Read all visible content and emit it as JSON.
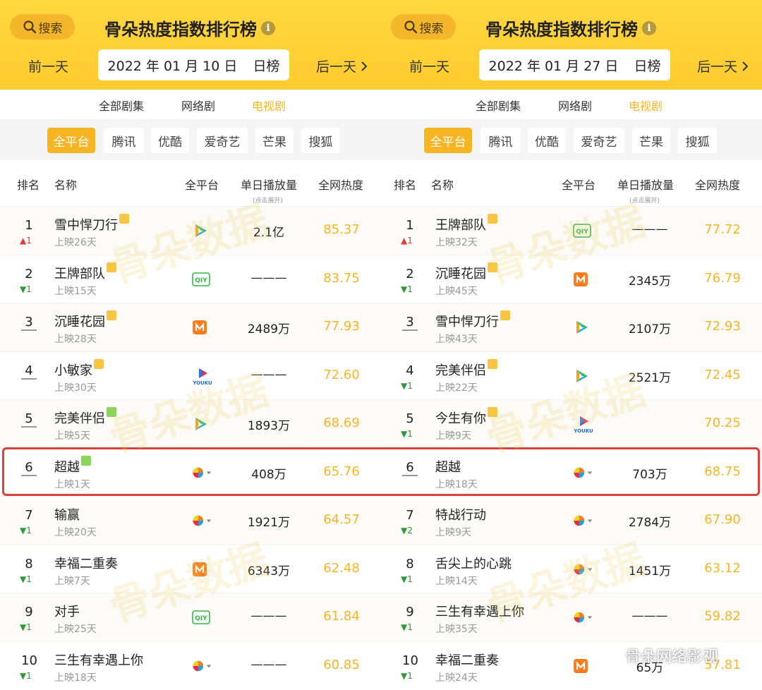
{
  "colors": {
    "header_yellow": "#ffd23a",
    "accent": "#f7b524",
    "up": "#e23c3c",
    "down": "#2e9a3a",
    "highlight": "#d9413a"
  },
  "watermark_text": "骨朵数据",
  "watermark_sub": "@骨朵网络影视",
  "footer": {
    "account": "骨朵网络影视",
    "icon": "wechat-icon"
  },
  "panels": [
    {
      "search_label": "搜索",
      "title": "骨朵热度指数排行榜",
      "prev_label": "前一天",
      "date": "2022 年 01 月 10 日",
      "board": "日榜",
      "next_label": "后一天",
      "categories": [
        "全部剧集",
        "网络剧",
        "电视剧"
      ],
      "platforms": [
        "全平台",
        "腾讯",
        "优酷",
        "爱奇艺",
        "芒果",
        "搜狐"
      ],
      "columns": {
        "rank": "排名",
        "name": "名称",
        "platform": "全平台",
        "plays": "单日播放量",
        "plays_hint": "(点击展开)",
        "heat": "全网热度"
      },
      "rows": [
        {
          "rank": "1",
          "trend": "1",
          "trend_dir": "up",
          "name": "雪中悍刀行",
          "tag": "orange",
          "days": "上映26天",
          "platform": "tencent",
          "plays": "2.1亿",
          "heat": "85.37"
        },
        {
          "rank": "2",
          "trend": "1",
          "trend_dir": "down",
          "name": "王牌部队",
          "tag": "orange",
          "days": "上映15天",
          "platform": "iqiyi",
          "plays": "———",
          "heat": "83.75"
        },
        {
          "rank": "3",
          "trend": "",
          "trend_dir": "flat",
          "name": "沉睡花园",
          "tag": "orange",
          "days": "上映28天",
          "platform": "mango",
          "plays": "2489万",
          "heat": "77.93"
        },
        {
          "rank": "4",
          "trend": "",
          "trend_dir": "flat",
          "name": "小敏家",
          "tag": "orange",
          "days": "上映30天",
          "platform": "youku",
          "plays": "———",
          "heat": "72.60"
        },
        {
          "rank": "5",
          "trend": "",
          "trend_dir": "flat",
          "name": "完美伴侣",
          "tag": "green",
          "days": "上映5天",
          "platform": "tencent",
          "plays": "1893万",
          "heat": "68.69"
        },
        {
          "rank": "6",
          "trend": "",
          "trend_dir": "flat",
          "name": "超越",
          "tag": "green",
          "days": "上映1天",
          "platform": "multi",
          "plays": "408万",
          "heat": "65.76"
        },
        {
          "rank": "7",
          "trend": "1",
          "trend_dir": "down",
          "name": "输赢",
          "tag": "",
          "days": "上映20天",
          "platform": "multi",
          "plays": "1921万",
          "heat": "64.57"
        },
        {
          "rank": "8",
          "trend": "1",
          "trend_dir": "down",
          "name": "幸福二重奏",
          "tag": "",
          "days": "上映7天",
          "platform": "mango",
          "plays": "6343万",
          "heat": "62.48"
        },
        {
          "rank": "9",
          "trend": "1",
          "trend_dir": "down",
          "name": "对手",
          "tag": "",
          "days": "上映25天",
          "platform": "iqiyi",
          "plays": "———",
          "heat": "61.84"
        },
        {
          "rank": "10",
          "trend": "1",
          "trend_dir": "down",
          "name": "三生有幸遇上你",
          "tag": "",
          "days": "上映18天",
          "platform": "multi",
          "plays": "———",
          "heat": "60.85"
        }
      ]
    },
    {
      "search_label": "搜索",
      "title": "骨朵热度指数排行榜",
      "prev_label": "前一天",
      "date": "2022 年 01 月 27 日",
      "board": "日榜",
      "next_label": "后一天",
      "categories": [
        "全部剧集",
        "网络剧",
        "电视剧"
      ],
      "platforms": [
        "全平台",
        "腾讯",
        "优酷",
        "爱奇艺",
        "芒果",
        "搜狐"
      ],
      "columns": {
        "rank": "排名",
        "name": "名称",
        "platform": "全平台",
        "plays": "单日播放量",
        "plays_hint": "(点击展开)",
        "heat": "全网热度"
      },
      "rows": [
        {
          "rank": "1",
          "trend": "1",
          "trend_dir": "up",
          "name": "王牌部队",
          "tag": "orange",
          "days": "上映32天",
          "platform": "iqiyi",
          "plays": "———",
          "heat": "77.72"
        },
        {
          "rank": "2",
          "trend": "1",
          "trend_dir": "down",
          "name": "沉睡花园",
          "tag": "orange",
          "days": "上映45天",
          "platform": "mango",
          "plays": "2345万",
          "heat": "76.79"
        },
        {
          "rank": "3",
          "trend": "",
          "trend_dir": "flat",
          "name": "雪中悍刀行",
          "tag": "orange",
          "days": "上映43天",
          "platform": "tencent",
          "plays": "2107万",
          "heat": "72.93"
        },
        {
          "rank": "4",
          "trend": "1",
          "trend_dir": "down",
          "name": "完美伴侣",
          "tag": "orange",
          "days": "上映22天",
          "platform": "tencent",
          "plays": "2521万",
          "heat": "72.45"
        },
        {
          "rank": "5",
          "trend": "1",
          "trend_dir": "down",
          "name": "今生有你",
          "tag": "orange",
          "days": "上映9天",
          "platform": "youku",
          "plays": "",
          "heat": "70.25"
        },
        {
          "rank": "6",
          "trend": "",
          "trend_dir": "flat",
          "name": "超越",
          "tag": "",
          "days": "上映18天",
          "platform": "multi",
          "plays": "703万",
          "heat": "68.75"
        },
        {
          "rank": "7",
          "trend": "2",
          "trend_dir": "down",
          "name": "特战行动",
          "tag": "",
          "days": "上映9天",
          "platform": "multi",
          "plays": "2784万",
          "heat": "67.90"
        },
        {
          "rank": "8",
          "trend": "1",
          "trend_dir": "down",
          "name": "舌尖上的心跳",
          "tag": "",
          "days": "上映14天",
          "platform": "multi",
          "plays": "1451万",
          "heat": "63.12"
        },
        {
          "rank": "9",
          "trend": "1",
          "trend_dir": "down",
          "name": "三生有幸遇上你",
          "tag": "",
          "days": "上映35天",
          "platform": "multi",
          "plays": "———",
          "heat": "59.82"
        },
        {
          "rank": "10",
          "trend": "1",
          "trend_dir": "down",
          "name": "幸福二重奏",
          "tag": "",
          "days": "上映24天",
          "platform": "mango",
          "plays": "65万",
          "heat": "57.81"
        }
      ]
    }
  ]
}
